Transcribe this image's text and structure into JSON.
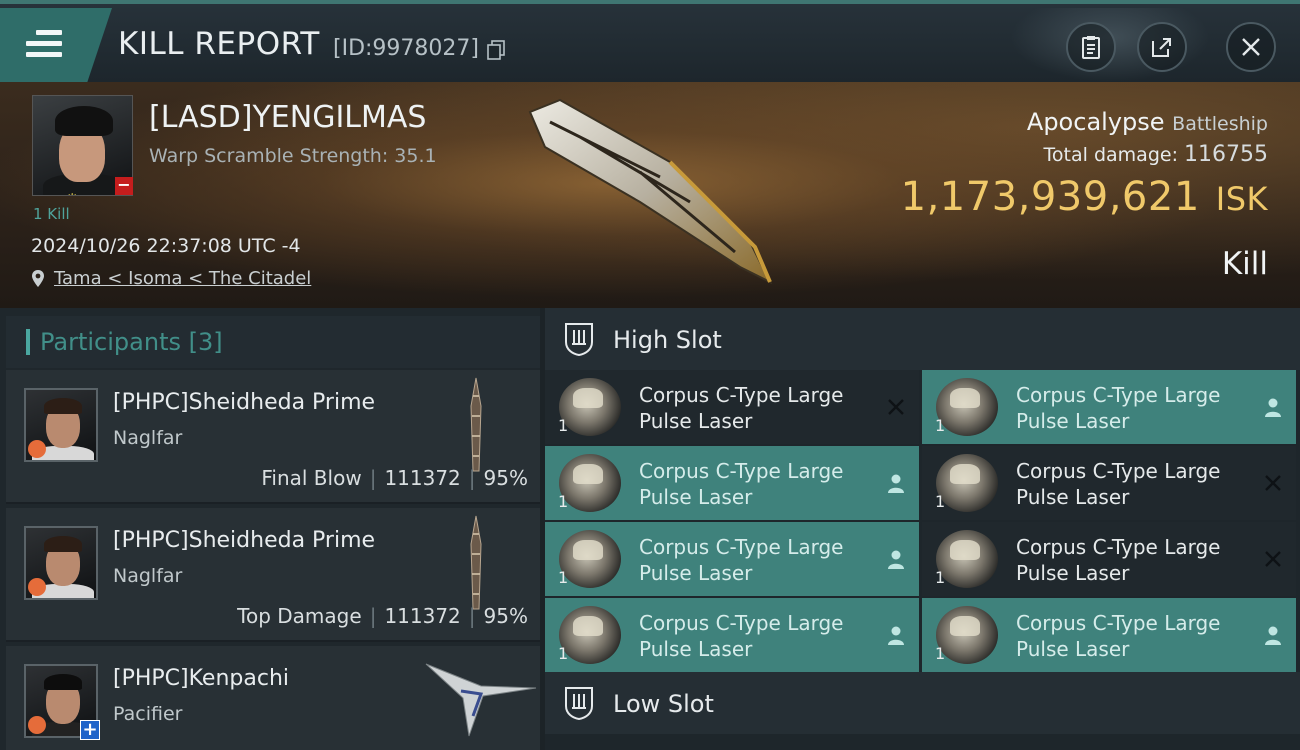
{
  "header": {
    "title": "KILL REPORT",
    "report_id": "[ID:9978027]"
  },
  "victim": {
    "name": "[LASD]YENGILMAS",
    "warp_scramble": "Warp Scramble Strength: 35.1",
    "kills": "1 Kill",
    "datetime": "2024/10/26 22:37:08 UTC -4",
    "location": "Tama < Isoma < The Citadel",
    "ship_name": "Apocalypse",
    "ship_class": "Battleship",
    "total_damage_label": "Total damage:",
    "total_damage": "116755",
    "isk_value": "1,173,939,621",
    "isk_unit": "ISK",
    "outcome": "Kill"
  },
  "participants": {
    "header": "Participants",
    "count": "[3]",
    "rows": [
      {
        "name": "[PHPC]Sheidheda Prime",
        "ship": "Naglfar",
        "role": "Final Blow",
        "damage": "111372",
        "percent": "95%"
      },
      {
        "name": "[PHPC]Sheidheda Prime",
        "ship": "Naglfar",
        "role": "Top Damage",
        "damage": "111372",
        "percent": "95%"
      },
      {
        "name": "[PHPC]Kenpachi",
        "ship": "Pacifier"
      }
    ]
  },
  "fitting": {
    "high_slot_title": "High Slot",
    "low_slot_title": "Low Slot",
    "modules": [
      {
        "line1": "Corpus C-Type Large",
        "line2": "Pulse Laser",
        "qty": "1",
        "status": "destroyed",
        "icon": "close-icon"
      },
      {
        "line1": "Corpus C-Type Large",
        "line2": "Pulse Laser",
        "qty": "1",
        "status": "dropped",
        "icon": "person-icon"
      },
      {
        "line1": "Corpus C-Type Large",
        "line2": "Pulse Laser",
        "qty": "1",
        "status": "dropped",
        "icon": "person-icon"
      },
      {
        "line1": "Corpus C-Type Large",
        "line2": "Pulse Laser",
        "qty": "1",
        "status": "destroyed",
        "icon": "close-icon"
      },
      {
        "line1": "Corpus C-Type Large",
        "line2": "Pulse Laser",
        "qty": "1",
        "status": "dropped",
        "icon": "person-icon"
      },
      {
        "line1": "Corpus C-Type Large",
        "line2": "Pulse Laser",
        "qty": "1",
        "status": "destroyed",
        "icon": "close-icon"
      },
      {
        "line1": "Corpus C-Type Large",
        "line2": "Pulse Laser",
        "qty": "1",
        "status": "dropped",
        "icon": "person-icon"
      },
      {
        "line1": "Corpus C-Type Large",
        "line2": "Pulse Laser",
        "qty": "1",
        "status": "dropped",
        "icon": "person-icon"
      }
    ]
  },
  "colors": {
    "accent_teal": "#3f827c",
    "isk_gold": "#f0c96a",
    "badge_red": "#c51d1d"
  }
}
